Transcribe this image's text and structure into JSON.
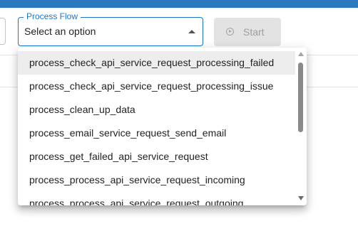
{
  "process_select": {
    "label": "Process Flow",
    "value": "Select an option",
    "options": [
      "process_check_api_service_request_processing_failed",
      "process_check_api_service_request_processing_issue",
      "process_clean_up_data",
      "process_email_service_request_send_email",
      "process_get_failed_api_service_request",
      "process_process_api_service_request_incoming",
      "process_process_api_service_request_outgoing"
    ],
    "hovered_index": 0
  },
  "toolbar": {
    "start_label": "Start",
    "start_icon": "play-circle-icon"
  },
  "colors": {
    "top_bar": "#2a78c0",
    "accent": "#1976d2",
    "disabled_button_bg": "#e3e3e3",
    "hover_bg": "#ededed"
  }
}
